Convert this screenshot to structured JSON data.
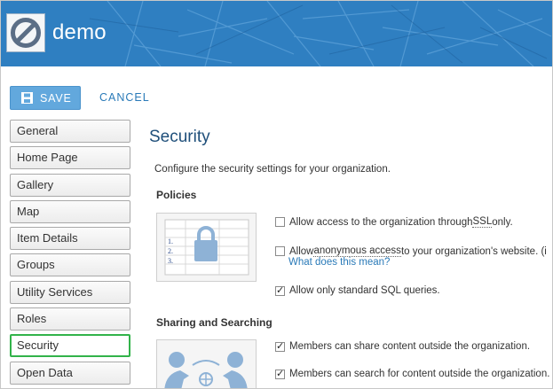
{
  "header": {
    "org_name": "demo",
    "brand_color": "#2f7fc1"
  },
  "toolbar": {
    "save_label": "SAVE",
    "cancel_label": "CANCEL"
  },
  "sidebar": {
    "items": [
      {
        "label": "General"
      },
      {
        "label": "Home Page"
      },
      {
        "label": "Gallery"
      },
      {
        "label": "Map"
      },
      {
        "label": "Item Details"
      },
      {
        "label": "Groups"
      },
      {
        "label": "Utility Services"
      },
      {
        "label": "Roles"
      },
      {
        "label": "Security",
        "active": true
      },
      {
        "label": "Open Data"
      }
    ],
    "active_color": "#32b34a"
  },
  "main": {
    "title": "Security",
    "description": "Configure the security settings for your organization.",
    "policies": {
      "heading": "Policies",
      "ssl": {
        "pre": "Allow access to the organization through ",
        "term": "SSL",
        "post": " only.",
        "checked": false
      },
      "anonymous": {
        "pre": "Allow ",
        "term": "anonymous access",
        "post": " to your organization's website. (i",
        "checked": false
      },
      "what_link": "What does this mean?",
      "sql": {
        "label": "Allow only standard SQL queries.",
        "checked": true
      }
    },
    "sharing": {
      "heading": "Sharing and Searching",
      "share_outside": {
        "label": "Members can share content outside the organization.",
        "checked": true
      },
      "search_outside": {
        "label": "Members can search for content outside the organization.",
        "checked": true
      }
    }
  }
}
